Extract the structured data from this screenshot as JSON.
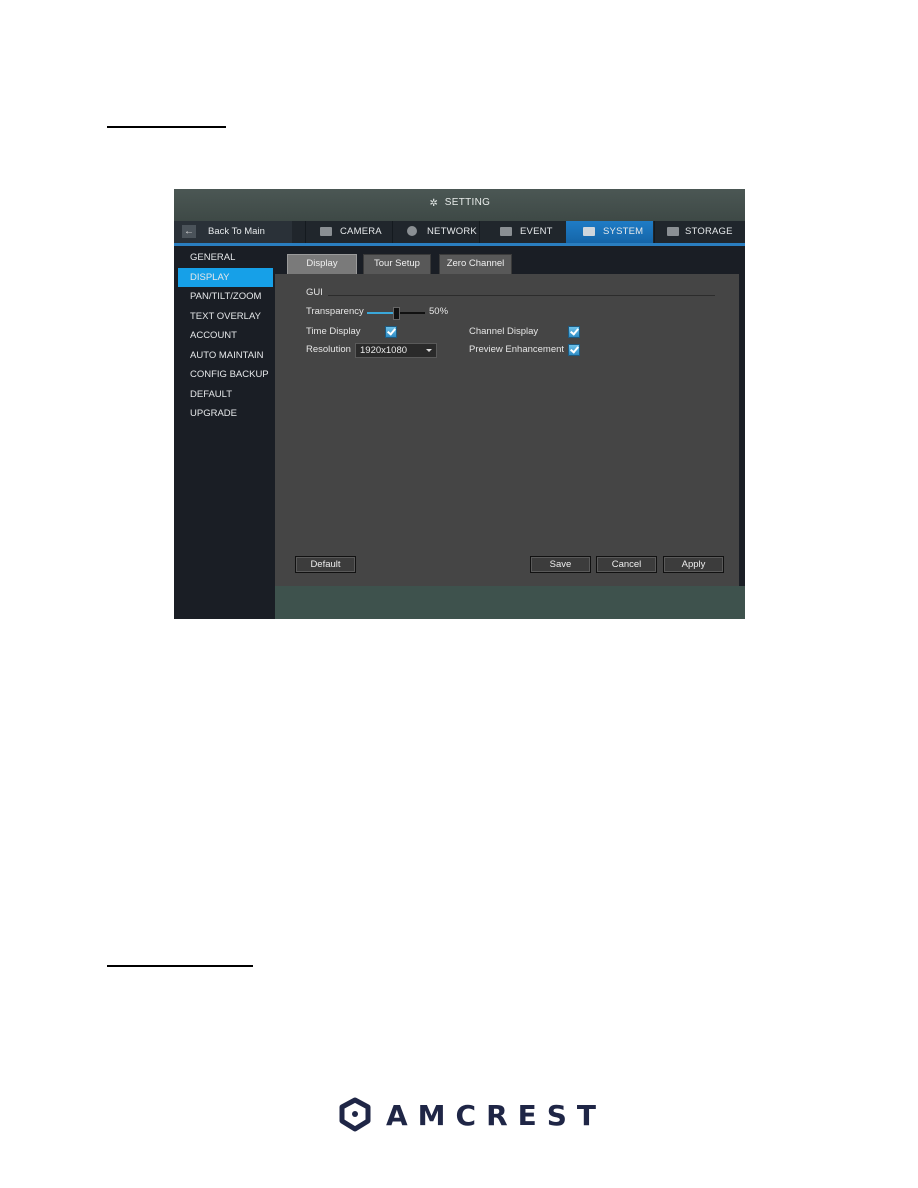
{
  "window": {
    "title": "SETTING",
    "title_icon": "gear-icon"
  },
  "nav": {
    "back_label": "Back To Main",
    "back_icon": "back-arrow-icon",
    "tabs": [
      {
        "label": "CAMERA",
        "icon": "camera-icon",
        "active": false
      },
      {
        "label": "NETWORK",
        "icon": "network-globe-icon",
        "active": false
      },
      {
        "label": "EVENT",
        "icon": "event-icon",
        "active": false
      },
      {
        "label": "SYSTEM",
        "icon": "system-icon",
        "active": true
      },
      {
        "label": "STORAGE",
        "icon": "storage-icon",
        "active": false
      }
    ],
    "accent_color": "#1f7cc6"
  },
  "sidebar": {
    "items": [
      {
        "label": "GENERAL",
        "active": false
      },
      {
        "label": "DISPLAY",
        "active": true
      },
      {
        "label": "PAN/TILT/ZOOM",
        "active": false
      },
      {
        "label": "TEXT OVERLAY",
        "active": false
      },
      {
        "label": "ACCOUNT",
        "active": false
      },
      {
        "label": "AUTO MAINTAIN",
        "active": false
      },
      {
        "label": "CONFIG BACKUP",
        "active": false
      },
      {
        "label": "DEFAULT",
        "active": false
      },
      {
        "label": "UPGRADE",
        "active": false
      }
    ],
    "active_color": "#16a0e8",
    "logo_text": "AMCREST"
  },
  "subtabs": [
    {
      "label": "Display",
      "active": true
    },
    {
      "label": "Tour Setup",
      "active": false
    },
    {
      "label": "Zero Channel",
      "active": false
    }
  ],
  "gui": {
    "section_label": "GUI",
    "transparency_label": "Transparency",
    "transparency_value": 50,
    "transparency_text": "50%",
    "time_display_label": "Time Display",
    "time_display_checked": true,
    "channel_display_label": "Channel Display",
    "channel_display_checked": true,
    "resolution_label": "Resolution",
    "resolution_value": "1920x1080",
    "preview_enhancement_label": "Preview Enhancement",
    "preview_enhancement_checked": true
  },
  "buttons": {
    "default": "Default",
    "save": "Save",
    "cancel": "Cancel",
    "apply": "Apply"
  },
  "footer": {
    "brand": "AMCREST"
  }
}
